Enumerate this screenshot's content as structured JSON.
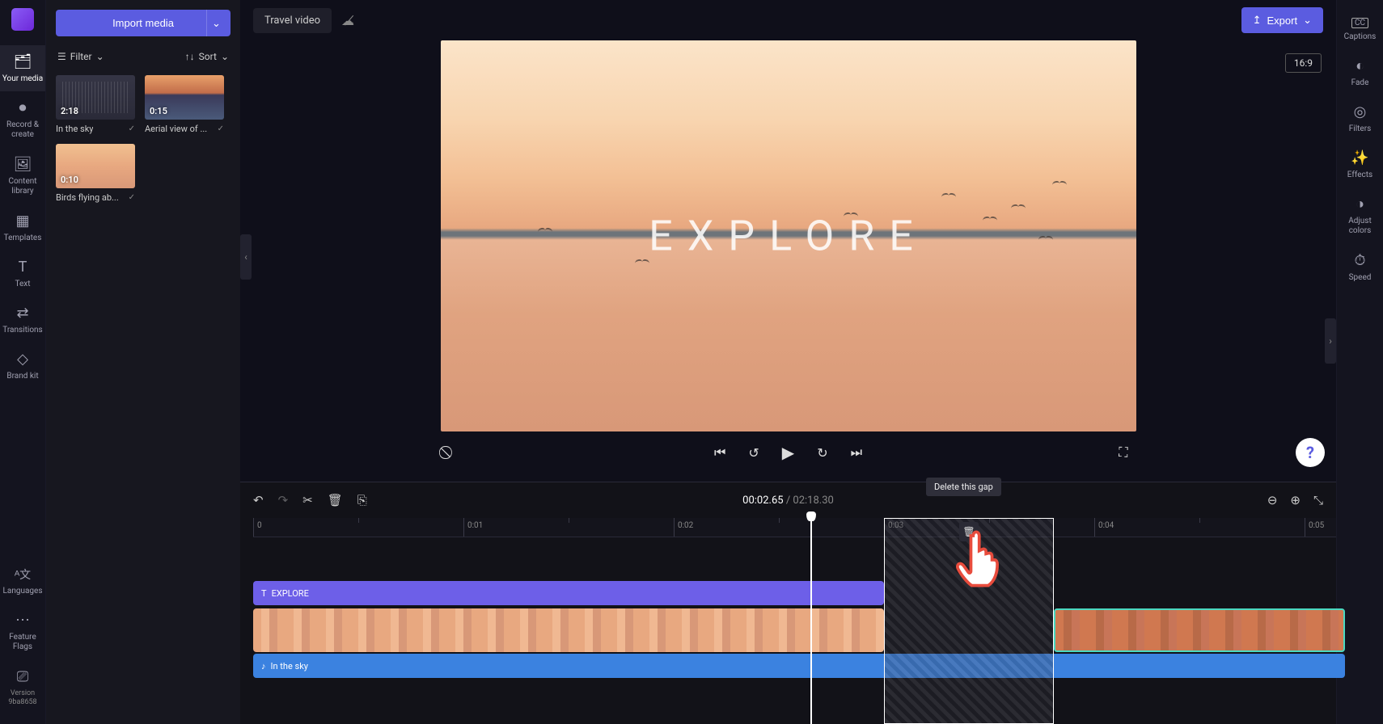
{
  "header": {
    "import_label": "Import media",
    "project_name": "Travel video",
    "export_label": "Export",
    "aspect_ratio": "16:9"
  },
  "left_sidebar": {
    "items": [
      {
        "label": "Your media"
      },
      {
        "label": "Record & create"
      },
      {
        "label": "Content library"
      },
      {
        "label": "Templates"
      },
      {
        "label": "Text"
      },
      {
        "label": "Transitions"
      },
      {
        "label": "Brand kit"
      }
    ],
    "bottom": [
      {
        "label": "Languages"
      },
      {
        "label": "Feature Flags"
      }
    ],
    "version_label": "Version",
    "version_value": "9ba8658"
  },
  "media_panel": {
    "filter_label": "Filter",
    "sort_label": "Sort",
    "items": [
      {
        "duration": "2:18",
        "name": "In the sky"
      },
      {
        "duration": "0:15",
        "name": "Aerial view of ..."
      },
      {
        "duration": "0:10",
        "name": "Birds flying ab..."
      }
    ]
  },
  "right_sidebar": {
    "items": [
      {
        "label": "Captions"
      },
      {
        "label": "Fade"
      },
      {
        "label": "Filters"
      },
      {
        "label": "Effects"
      },
      {
        "label": "Adjust colors"
      },
      {
        "label": "Speed"
      }
    ]
  },
  "preview": {
    "overlay_text": "EXPLORE"
  },
  "timeline": {
    "current_time": "00:02.65",
    "total_time": "02:18.30",
    "ticks": [
      "0",
      "0:01",
      "0:02",
      "0:03",
      "0:04",
      "0:05"
    ],
    "text_clip_label": "EXPLORE",
    "audio_clip_label": "In the sky",
    "tooltip": "Delete this gap"
  },
  "colors": {
    "accent": "#5b5ce0",
    "text_clip": "#6d5fe8",
    "audio_clip": "#3b82e0",
    "teal_border": "#4ad8c0"
  }
}
